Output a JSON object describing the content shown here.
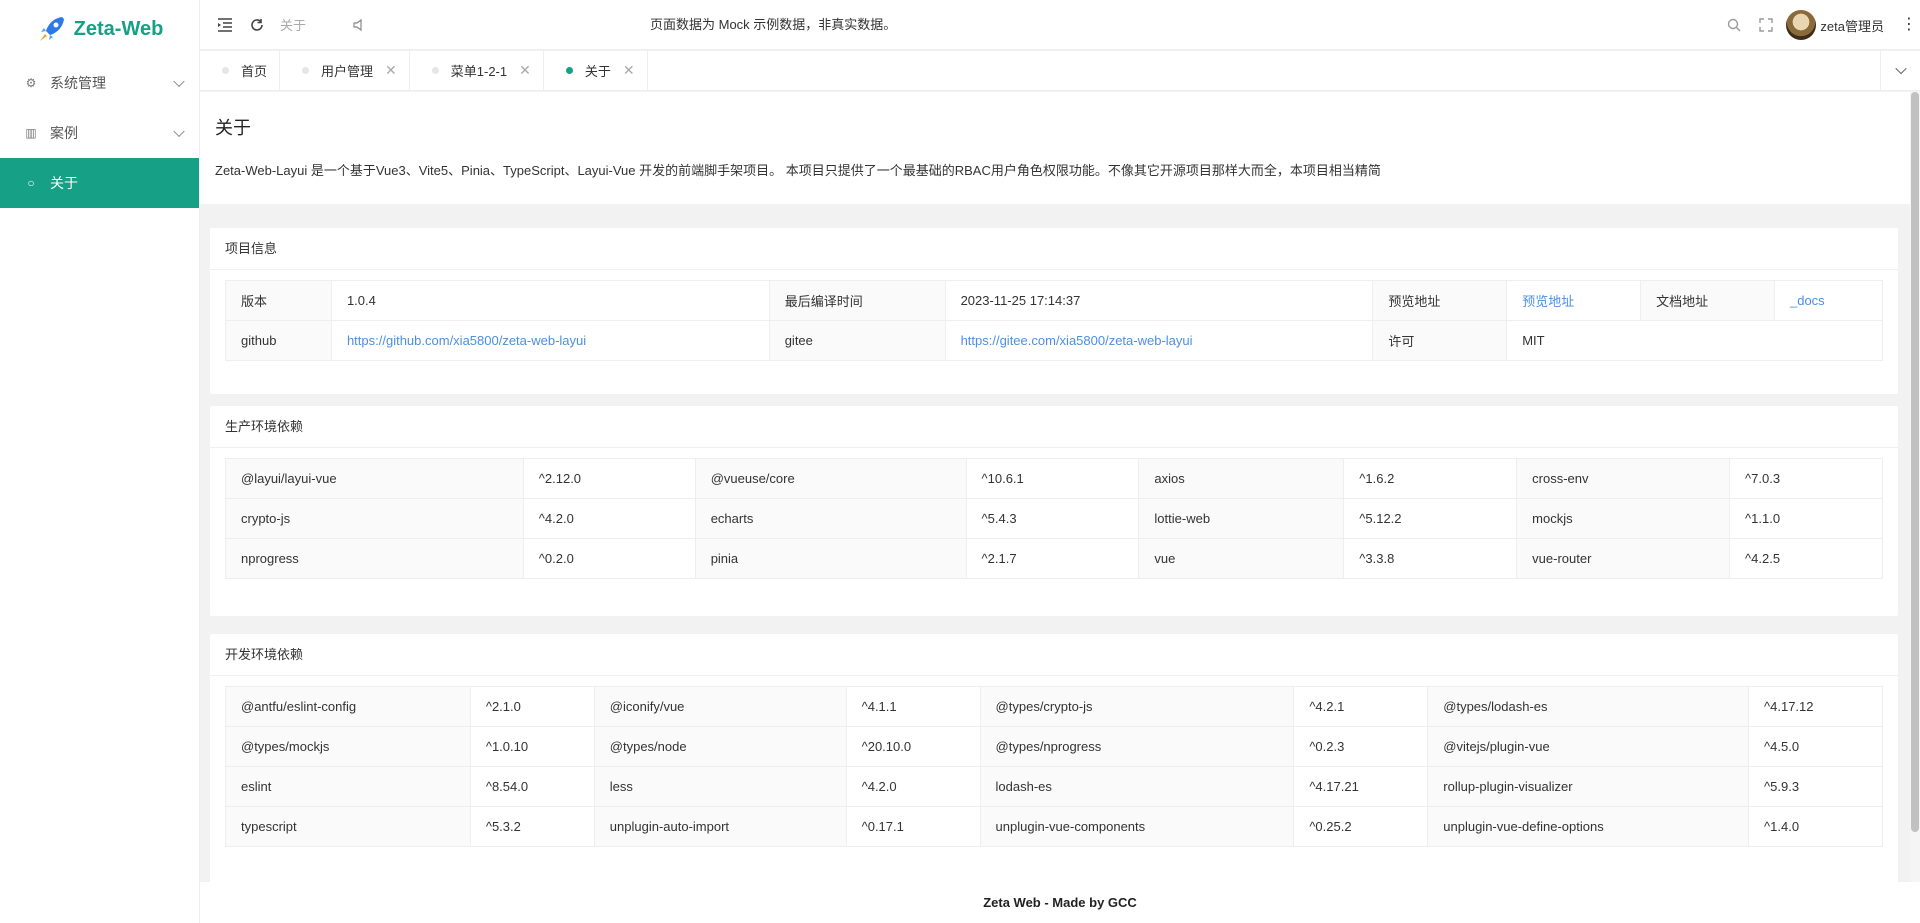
{
  "brand": {
    "name": "Zeta-Web",
    "accent": "#16a085"
  },
  "sidebar": {
    "items": [
      {
        "label": "系统管理",
        "icon": "gear-icon",
        "expandable": true
      },
      {
        "label": "案例",
        "icon": "book-icon",
        "expandable": true
      },
      {
        "label": "关于",
        "icon": "info-circle-icon",
        "active": true
      }
    ]
  },
  "header": {
    "breadcrumb": "关于",
    "notice": "页面数据为 Mock 示例数据，非真实数据。",
    "user_name": "zeta管理员"
  },
  "tabs": [
    {
      "label": "首页",
      "closable": false
    },
    {
      "label": "用户管理",
      "closable": true
    },
    {
      "label": "菜单1-2-1",
      "closable": true
    },
    {
      "label": "关于",
      "closable": true,
      "active": true
    }
  ],
  "page": {
    "title": "关于",
    "description": "Zeta-Web-Layui 是一个基于Vue3、Vite5、Pinia、TypeScript、Layui-Vue 开发的前端脚手架项目。 本项目只提供了一个最基础的RBAC用户角色权限功能。不像其它开源项目那样大而全，本项目相当精简"
  },
  "project_info": {
    "title": "项目信息",
    "version_label": "版本",
    "version": "1.0.4",
    "build_time_label": "最后编译时间",
    "build_time": "2023-11-25 17:14:37",
    "preview_label": "预览地址",
    "preview_link": "预览地址",
    "docs_label": "文档地址",
    "docs_link": "_docs",
    "github_label": "github",
    "github_url": "https://github.com/xia5800/zeta-web-layui",
    "gitee_label": "gitee",
    "gitee_url": "https://gitee.com/xia5800/zeta-web-layui",
    "license_label": "许可",
    "license": "MIT"
  },
  "prod_deps": {
    "title": "生产环境依赖",
    "rows": [
      [
        [
          "@layui/layui-vue",
          "^2.12.0"
        ],
        [
          "@vueuse/core",
          "^10.6.1"
        ],
        [
          "axios",
          "^1.6.2"
        ],
        [
          "cross-env",
          "^7.0.3"
        ]
      ],
      [
        [
          "crypto-js",
          "^4.2.0"
        ],
        [
          "echarts",
          "^5.4.3"
        ],
        [
          "lottie-web",
          "^5.12.2"
        ],
        [
          "mockjs",
          "^1.1.0"
        ]
      ],
      [
        [
          "nprogress",
          "^0.2.0"
        ],
        [
          "pinia",
          "^2.1.7"
        ],
        [
          "vue",
          "^3.3.8"
        ],
        [
          "vue-router",
          "^4.2.5"
        ]
      ]
    ]
  },
  "dev_deps": {
    "title": "开发环境依赖",
    "rows": [
      [
        [
          "@antfu/eslint-config",
          "^2.1.0"
        ],
        [
          "@iconify/vue",
          "^4.1.1"
        ],
        [
          "@types/crypto-js",
          "^4.2.1"
        ],
        [
          "@types/lodash-es",
          "^4.17.12"
        ]
      ],
      [
        [
          "@types/mockjs",
          "^1.0.10"
        ],
        [
          "@types/node",
          "^20.10.0"
        ],
        [
          "@types/nprogress",
          "^0.2.3"
        ],
        [
          "@vitejs/plugin-vue",
          "^4.5.0"
        ]
      ],
      [
        [
          "eslint",
          "^8.54.0"
        ],
        [
          "less",
          "^4.2.0"
        ],
        [
          "lodash-es",
          "^4.17.21"
        ],
        [
          "rollup-plugin-visualizer",
          "^5.9.3"
        ]
      ],
      [
        [
          "typescript",
          "^5.3.2"
        ],
        [
          "unplugin-auto-import",
          "^0.17.1"
        ],
        [
          "unplugin-vue-components",
          "^0.25.2"
        ],
        [
          "unplugin-vue-define-options",
          "^1.4.0"
        ]
      ]
    ]
  },
  "footer": {
    "text": "Zeta Web - Made by GCC"
  }
}
